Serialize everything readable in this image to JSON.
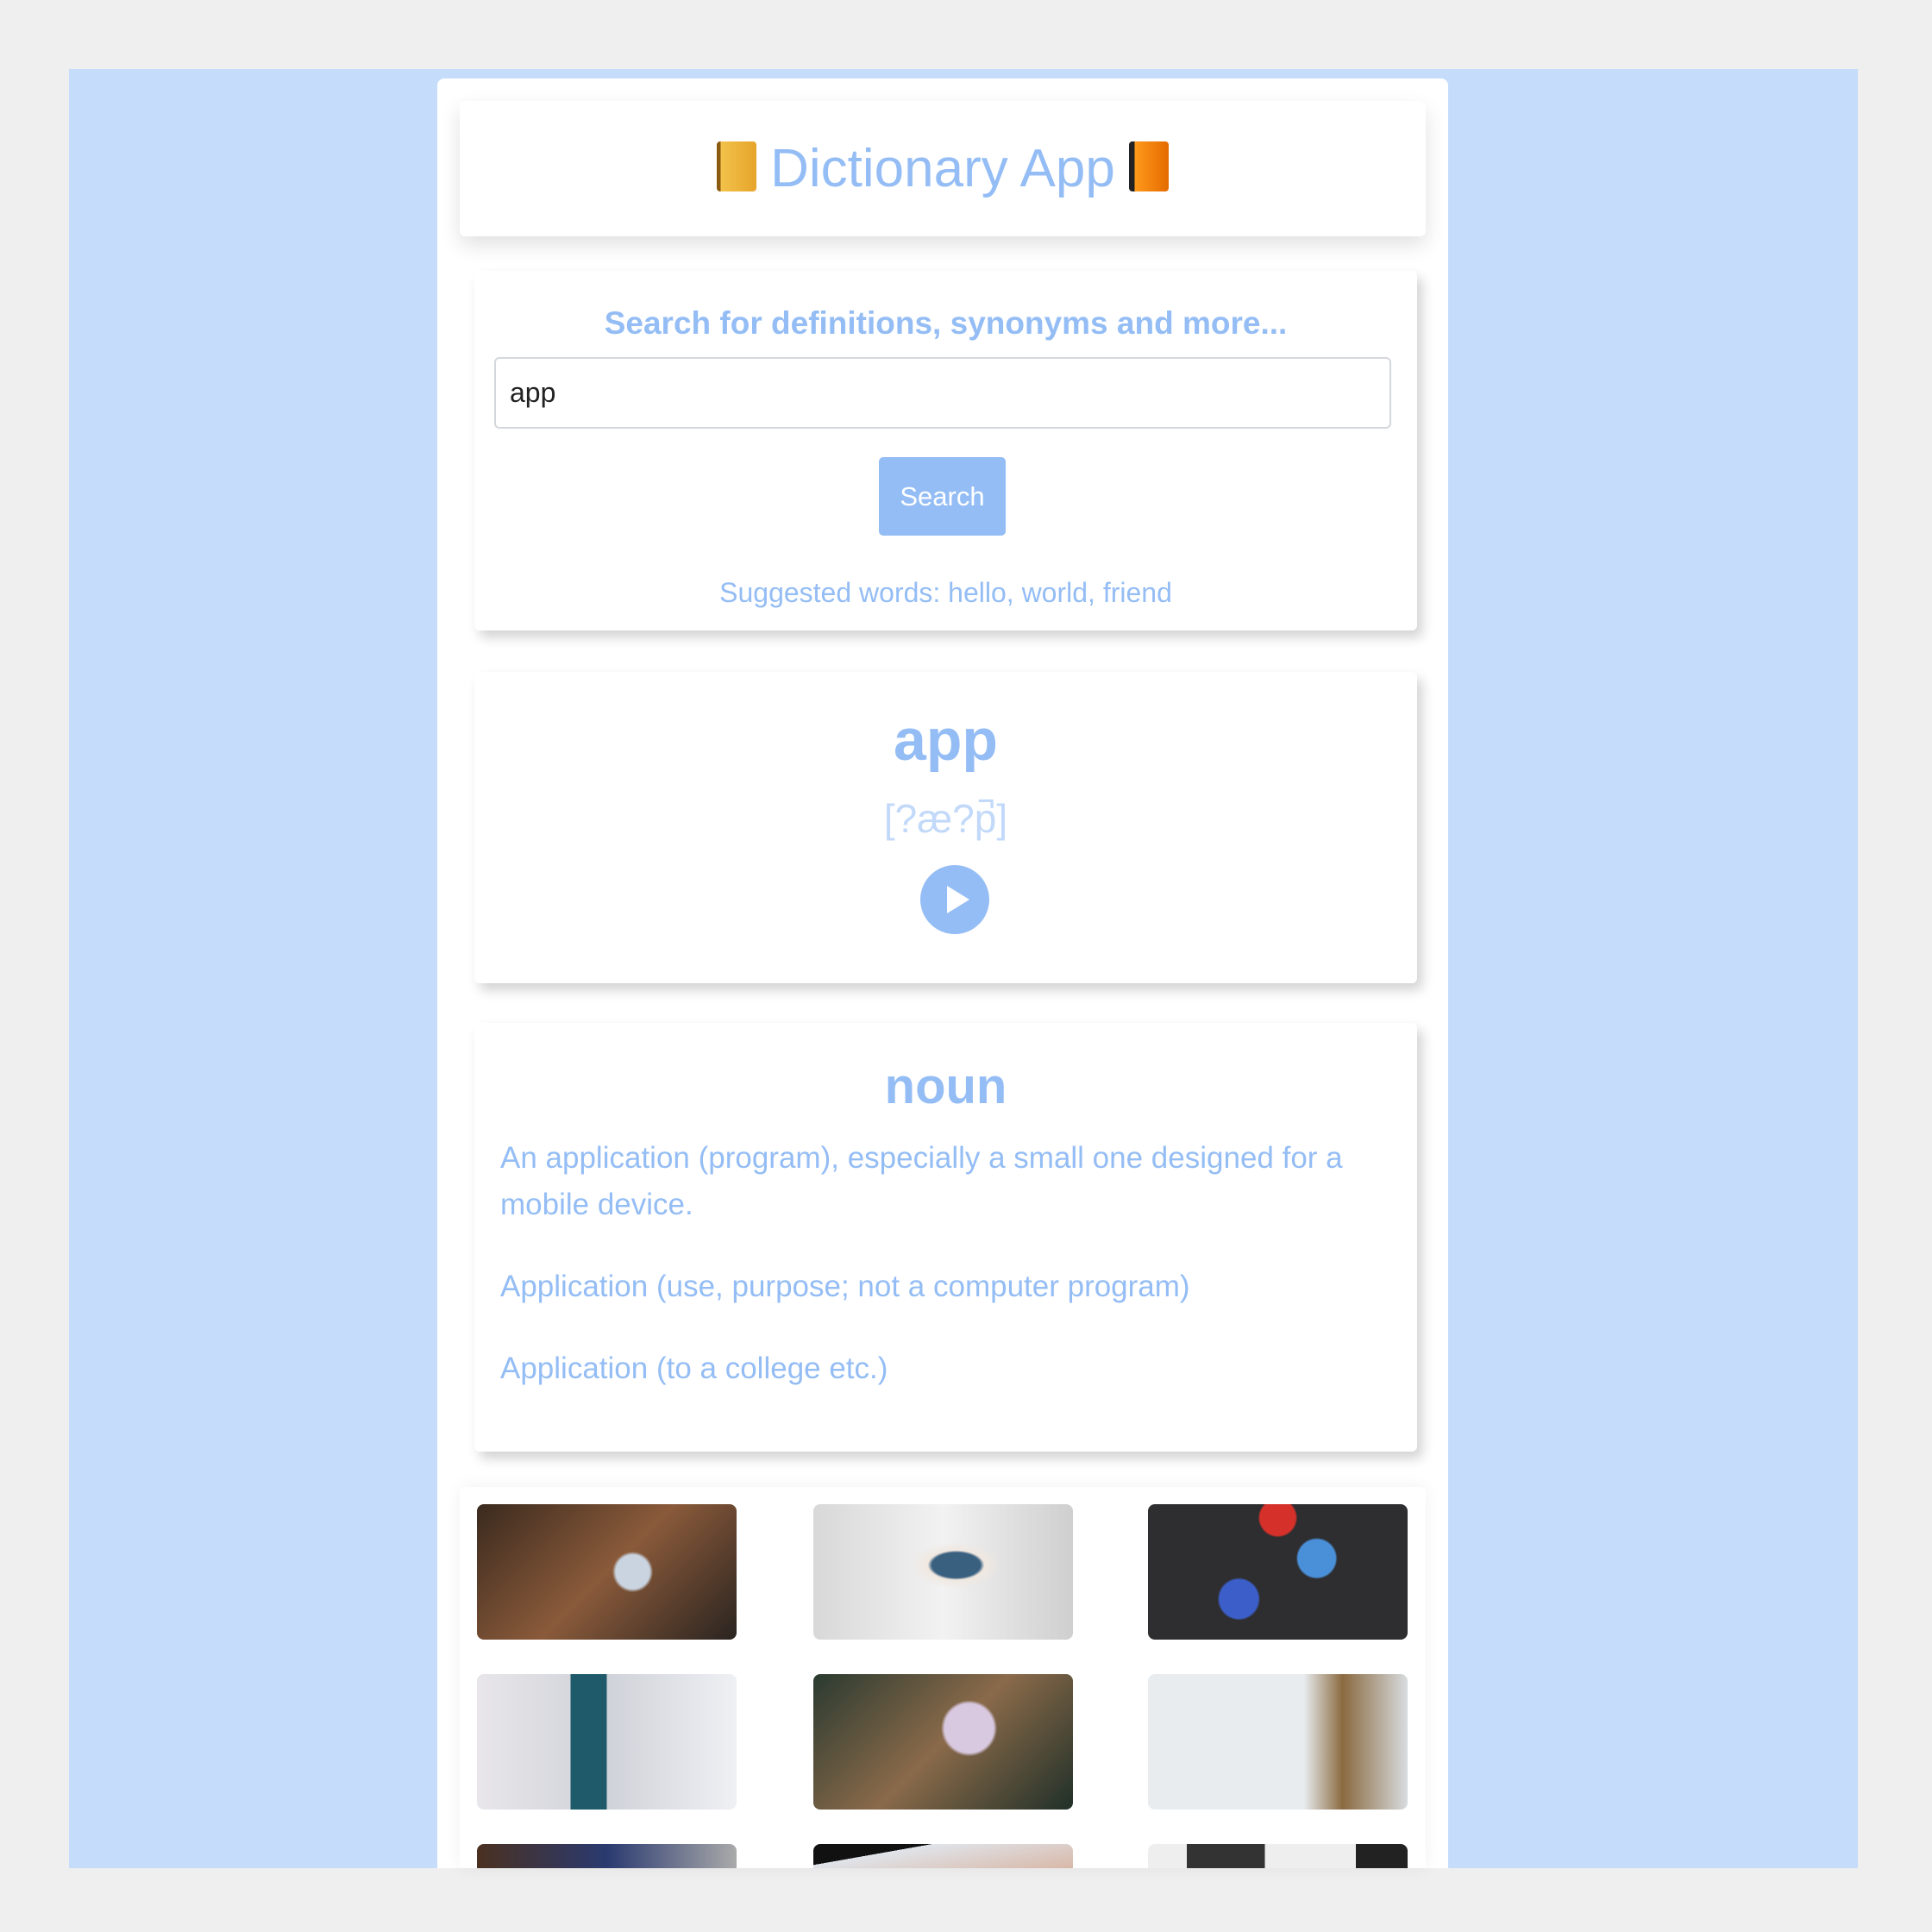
{
  "header": {
    "title": "Dictionary App",
    "left_icon": "notebook-emoji",
    "right_icon": "orange-book-emoji"
  },
  "search": {
    "subtitle": "Search for definitions, synonyms and more...",
    "input_value": "app",
    "button_label": "Search",
    "suggested": "Suggested words: hello, world, friend"
  },
  "word": {
    "text": "app",
    "phonetic": "[?æ?p̚]",
    "audio_icon": "play-icon"
  },
  "meaning": {
    "part_of_speech": "noun",
    "definitions": [
      "An application (program), especially a small one designed for a mobile device.",
      "Application (use, purpose; not a computer program)",
      "Application (to a college etc.)"
    ]
  },
  "colors": {
    "accent": "#94bdf5",
    "background": "#c5dcfa"
  }
}
